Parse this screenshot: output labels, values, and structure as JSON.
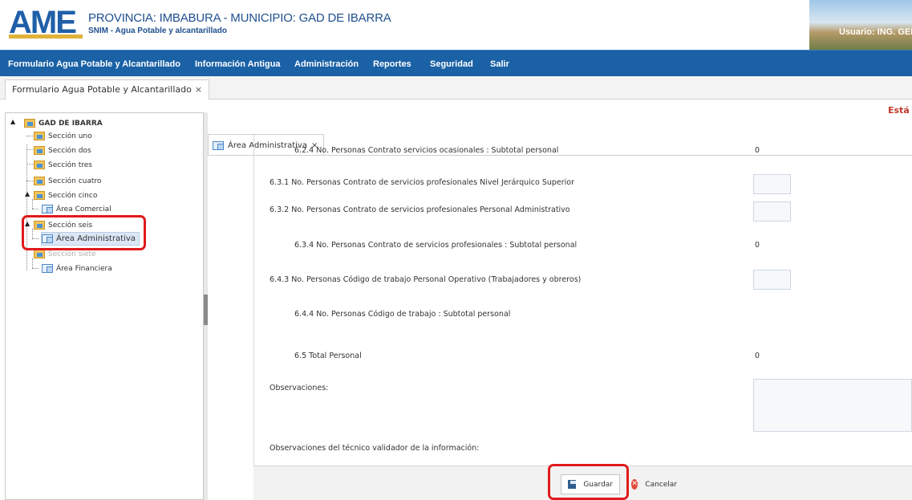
{
  "header": {
    "logo_text": "AME",
    "title": "PROVINCIA: IMBABURA - MUNICIPIO: GAD DE IBARRA",
    "subtitle": "SNIM - Agua Potable y alcantarillado",
    "user_label": "Usuario: ING. GERMA"
  },
  "menu": {
    "items": [
      {
        "label": "Formulario Agua Potable y Alcantarillado"
      },
      {
        "label": "Información Antigua"
      },
      {
        "label": "Administración"
      },
      {
        "label": "Reportes"
      },
      {
        "label": "Seguridad"
      },
      {
        "label": "Salir"
      }
    ]
  },
  "tabs": {
    "main_label": "Formulario Agua Potable y Alcantarillado",
    "close_glyph": "×"
  },
  "status": {
    "warning_text": "Está i"
  },
  "tree": {
    "root": "GAD DE IBARRA",
    "nodes": [
      {
        "label": "Sección uno"
      },
      {
        "label": "Sección dos"
      },
      {
        "label": "Sección tres"
      },
      {
        "label": "Sección cuatro"
      },
      {
        "label": "Sección cinco"
      },
      {
        "label": "Área Comercial"
      },
      {
        "label": "Sección seis"
      },
      {
        "label": "Área Administrativa"
      },
      {
        "label": "Sección siete"
      },
      {
        "label": "Área Financiera"
      }
    ]
  },
  "content_tab": {
    "label": "Área Administrativa",
    "close_glyph": "×"
  },
  "form": {
    "rows": [
      {
        "label": "6.2.4 No. Personas Contrato servicios ocasionales : Subtotal personal",
        "value": "0"
      },
      {
        "label": "6.3.1 No. Personas Contrato de servicios profesionales Nivel Jerárquico Superior",
        "value": ""
      },
      {
        "label": "6.3.2 No. Personas Contrato de servicios profesionales Personal Administrativo",
        "value": ""
      },
      {
        "label": "6.3.4 No. Personas Contrato de servicios profesionales : Subtotal personal",
        "value": "0"
      },
      {
        "label": "6.4.3 No. Personas Código de trabajo Personal Operativo (Trabajadores y obreros)",
        "value": ""
      },
      {
        "label": "6.4.4 No. Personas Código de trabajo : Subtotal personal",
        "value": ""
      },
      {
        "label": "6.5 Total Personal",
        "value": "0"
      }
    ],
    "observaciones_label": "Observaciones:",
    "observaciones_value": "",
    "validator_label": "Observaciones del técnico validador de la información:"
  },
  "actions": {
    "save_label": "Guardar",
    "cancel_label": "Cancelar"
  },
  "colors": {
    "menubar": "#1a61a6",
    "highlight": "#e01b1b"
  }
}
